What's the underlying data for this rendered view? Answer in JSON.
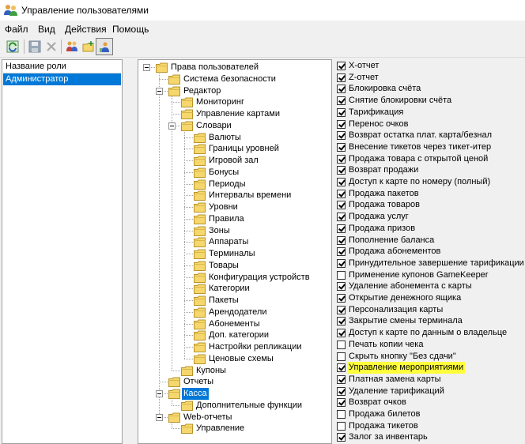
{
  "window": {
    "title": "Управление пользователями"
  },
  "menu": [
    "Файл",
    "Вид",
    "Действия",
    "Помощь"
  ],
  "toolbar": {
    "buttons": [
      {
        "name": "refresh-icon"
      },
      {
        "name": "save-icon"
      },
      {
        "name": "delete-icon"
      },
      {
        "name": "users-icon"
      },
      {
        "name": "add-folder-icon"
      },
      {
        "name": "user-access-icon"
      }
    ]
  },
  "roles": {
    "header": "Название роли",
    "items": [
      "Администратор"
    ]
  },
  "tree": {
    "items": [
      "Права пользователей",
      "Система безопасности",
      "Редактор",
      "Мониторинг",
      "Управление картами",
      "Словари",
      "Валюты",
      "Границы уровней",
      "Игровой зал",
      "Бонусы",
      "Периоды",
      "Интервалы времени",
      "Уровни",
      "Правила",
      "Зоны",
      "Аппараты",
      "Терминалы",
      "Товары",
      "Конфигурация устройств",
      "Категории",
      "Пакеты",
      "Арендодатели",
      "Абонементы",
      "Доп. категории",
      "Настройки репликации",
      "Ценовые схемы",
      "Купоны",
      "Отчеты",
      "Касса",
      "Дополнительные функции",
      "Web-отчеты",
      "Управление"
    ],
    "selected": "Касса"
  },
  "permissions": [
    {
      "label": "X-отчет",
      "checked": true
    },
    {
      "label": "Z-отчет",
      "checked": true
    },
    {
      "label": "Блокировка счёта",
      "checked": true
    },
    {
      "label": "Снятие блокировки счёта",
      "checked": true
    },
    {
      "label": "Тарификация",
      "checked": true
    },
    {
      "label": "Перенос очков",
      "checked": true
    },
    {
      "label": "Возврат остатка плат. карта/безнал",
      "checked": true
    },
    {
      "label": "Внесение тикетов через тикет-итер",
      "checked": true
    },
    {
      "label": "Продажа товара с открытой ценой",
      "checked": true
    },
    {
      "label": "Возврат продажи",
      "checked": true
    },
    {
      "label": "Доступ к карте по номеру (полный)",
      "checked": true
    },
    {
      "label": "Продажа пакетов",
      "checked": true
    },
    {
      "label": "Продажа товаров",
      "checked": true
    },
    {
      "label": "Продажа услуг",
      "checked": true
    },
    {
      "label": "Продажа призов",
      "checked": true
    },
    {
      "label": "Пополнение баланса",
      "checked": true
    },
    {
      "label": "Продажа абонементов",
      "checked": true
    },
    {
      "label": "Принудительное завершение тарификации",
      "checked": true
    },
    {
      "label": "Применение купонов GameKeeper",
      "checked": false
    },
    {
      "label": "Удаление абонемента с карты",
      "checked": true
    },
    {
      "label": "Открытие денежного ящика",
      "checked": true
    },
    {
      "label": "Персонализация карты",
      "checked": true
    },
    {
      "label": "Закрытие смены терминала",
      "checked": true
    },
    {
      "label": "Доступ к карте по данным о владельце",
      "checked": true
    },
    {
      "label": "Печать копии чека",
      "checked": false
    },
    {
      "label": "Скрыть кнопку \"Без сдачи\"",
      "checked": false
    },
    {
      "label": "Управление мероприятиями",
      "checked": true,
      "highlight": true
    },
    {
      "label": "Платная замена карты",
      "checked": true
    },
    {
      "label": "Удаление тарификаций",
      "checked": true
    },
    {
      "label": "Возврат очков",
      "checked": true
    },
    {
      "label": "Продажа билетов",
      "checked": false
    },
    {
      "label": "Продажа тикетов",
      "checked": false
    },
    {
      "label": "Залог за инвентарь",
      "checked": true
    }
  ],
  "colors": {
    "selection": "#0078d7",
    "highlight": "#ffff3c",
    "folder": "#f5d76e"
  }
}
